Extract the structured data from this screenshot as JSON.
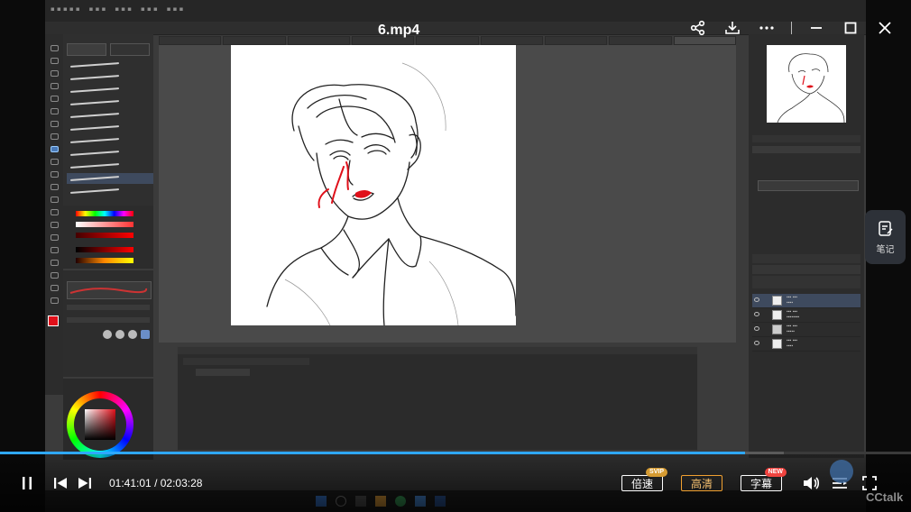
{
  "video": {
    "title": "6.mp4",
    "current_time": "01:41:01",
    "time_separator": "/",
    "duration": "02:03:28",
    "progress_fraction": 0.818,
    "buffered_fraction": 0.86
  },
  "top_controls": {
    "share_icon": "share-icon",
    "download_icon": "download-icon",
    "more_icon": "more-icon",
    "minimize_icon": "minimize-icon",
    "maximize_icon": "maximize-icon",
    "close_icon": "close-icon"
  },
  "side": {
    "notes_label": "笔记"
  },
  "controls": {
    "speed_label": "倍速",
    "speed_badge": "SVIP",
    "quality_label": "高清",
    "subtitle_label": "字幕",
    "subtitle_badge": "NEW"
  },
  "brand": {
    "logo_text": "CCtalk"
  },
  "colors": {
    "progress_played": "#2fa8ff",
    "hd_border": "#f0a030",
    "svip_badge": "#d59b32",
    "new_badge": "#f0433f",
    "selected_color": "#e0101a"
  }
}
